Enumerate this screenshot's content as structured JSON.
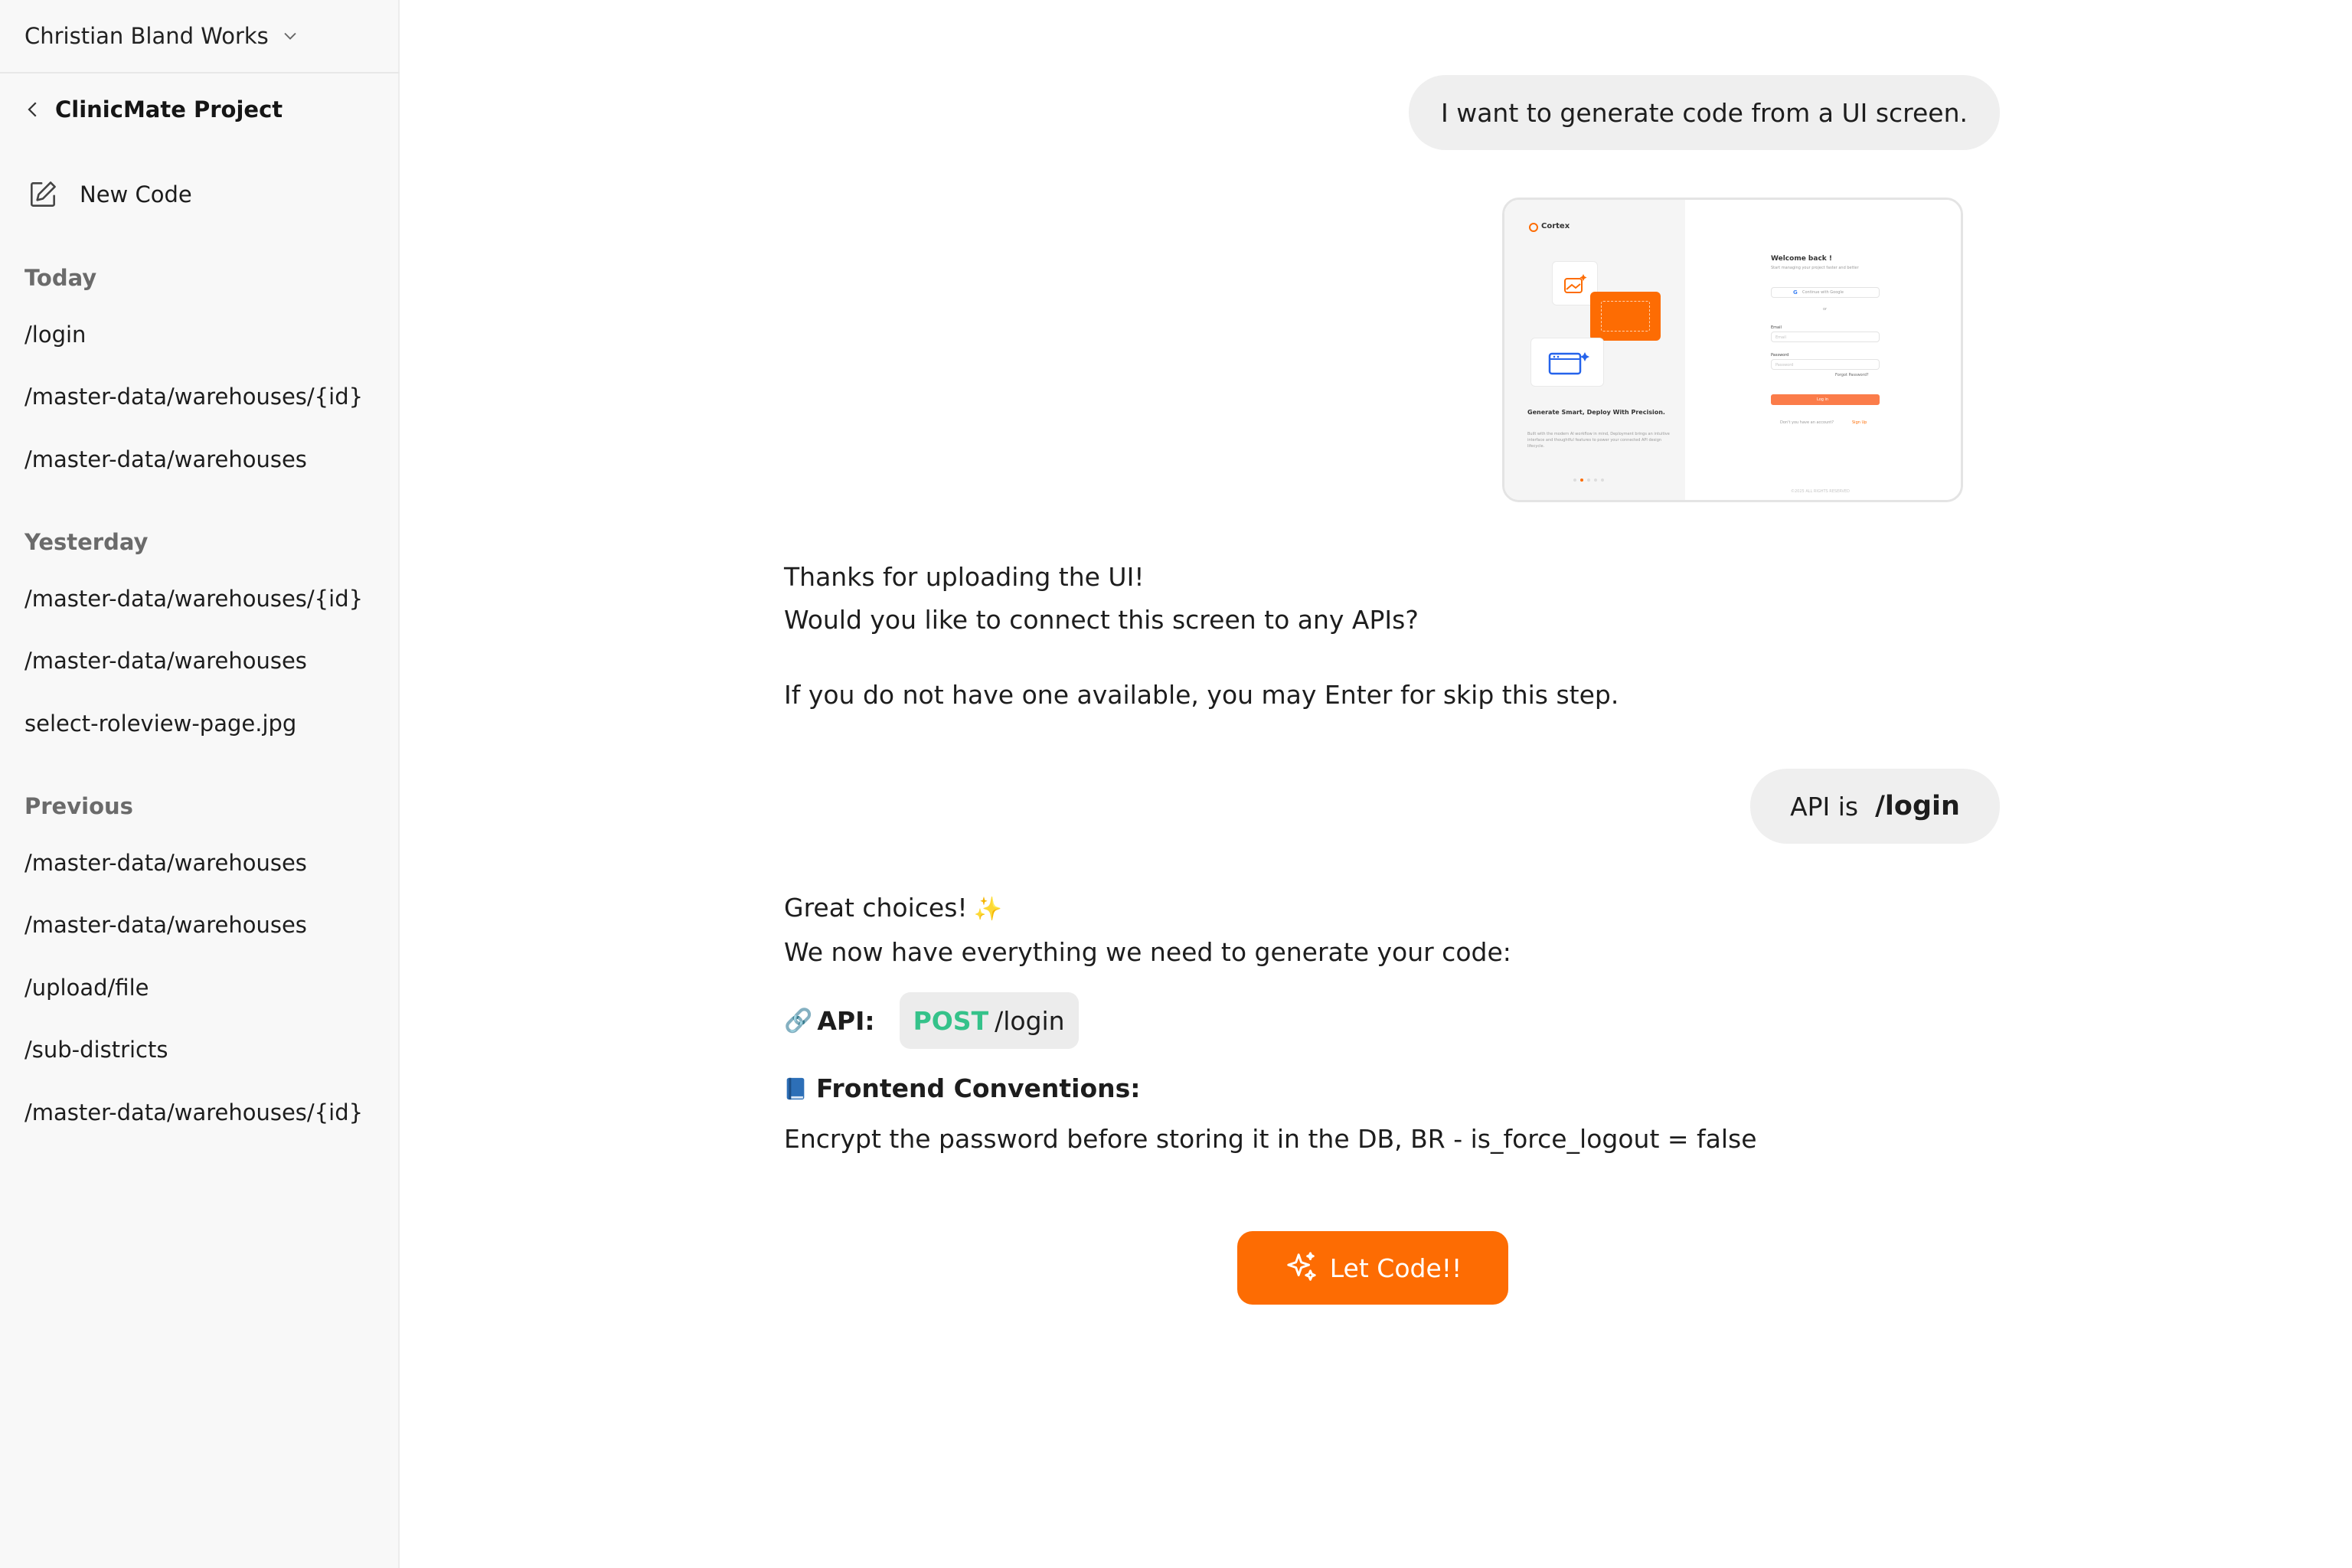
{
  "sidebar": {
    "workspace": "Christian Bland Works",
    "project": "ClinicMate Project",
    "new_code": "New Code",
    "sections": {
      "today": {
        "label": "Today",
        "items": [
          "/login",
          "/master-data/warehouses/{id}",
          "/master-data/warehouses"
        ]
      },
      "yesterday": {
        "label": "Yesterday",
        "items": [
          "/master-data/warehouses/{id}",
          "/master-data/warehouses",
          "select-roleview-page.jpg"
        ]
      },
      "previous": {
        "label": "Previous",
        "items": [
          "/master-data/warehouses",
          "/master-data/warehouses",
          "/upload/file",
          "/sub-districts",
          "/master-data/warehouses/{id}"
        ]
      }
    }
  },
  "chat": {
    "user_msg_1": "I want to generate code from a UI screen.",
    "preview": {
      "brand": "Cortex",
      "welcome": "Welcome back !",
      "subtitle": "Start managing your project faster and better",
      "google_btn": "Continue with Google",
      "or": "or",
      "email_label": "Email",
      "email_placeholder": "Email",
      "password_label": "Password",
      "password_placeholder": "Password",
      "forgot": "Forgot Password?",
      "login_btn": "Log in",
      "signup_prompt": "Don't you have an account?",
      "signup_link": "Sign Up",
      "headline": "Generate Smart, Deploy With Precision.",
      "body": "Built with the modern AI workflow in mind, Deployment brings an intuitive interface and thoughtful features to power your connected API design lifecycle.",
      "footer": "©2025 ALL RIGHTS RESERVED"
    },
    "bot_msg_1": {
      "line1": "Thanks for uploading the UI!",
      "line2": "Would you like to connect this screen to any APIs?",
      "line3": "If you do not have one available, you may Enter for skip this step."
    },
    "user_msg_2": {
      "prefix": "API is",
      "endpoint": "/login"
    },
    "bot_msg_2": {
      "line1": "Great choices!",
      "sparkle": "✨",
      "line2": "We now have everything we need to generate your code:",
      "api_icon": "🔗",
      "api_label": "API:",
      "api_method": "POST",
      "api_path": "/login",
      "conventions_label": "Frontend Conventions:",
      "conventions_text": "Encrypt the password before storing it in the DB, BR - is_force_logout = false"
    },
    "cta_label": "Let Code!!"
  },
  "colors": {
    "accent": "#fd6c03",
    "method_post": "#35c28a",
    "bubble_bg": "#efefef",
    "sidebar_bg": "#f8f8f8"
  },
  "icons": {
    "workspace": "chevron-down-icon",
    "back": "chevron-left-icon",
    "new_code": "pen-square-icon",
    "link": "link-icon",
    "conventions": "book-icon",
    "cta": "sparkles-icon"
  }
}
